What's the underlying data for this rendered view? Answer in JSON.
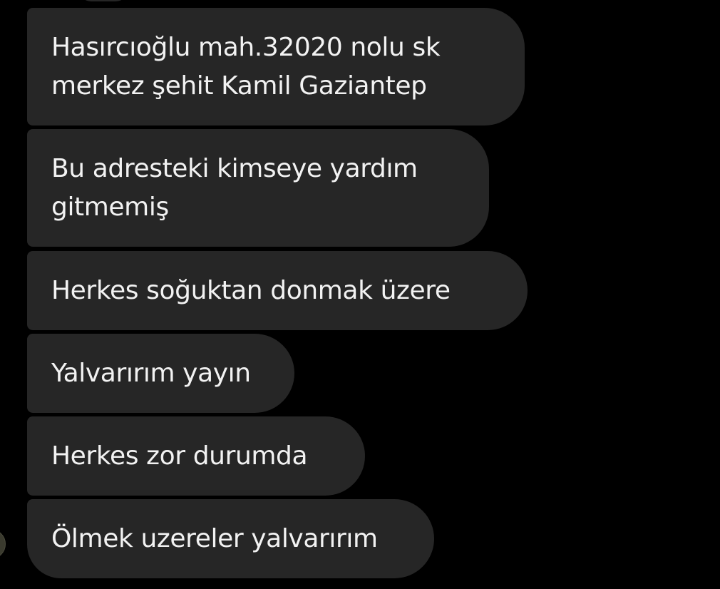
{
  "conversation": {
    "messages": [
      {
        "text": "Hasırcıoğlu mah.32020 nolu sk\nmerkez şehit Kamil Gaziantep"
      },
      {
        "text": "Bu adresteki kimseye yardım\ngitmemiş"
      },
      {
        "text": "Herkes soğuktan donmak üzere"
      },
      {
        "text": "Yalvarırım yayın"
      },
      {
        "text": "Herkes zor durumda"
      },
      {
        "text": "Ölmek uzereler yalvarırım"
      }
    ]
  },
  "colors": {
    "background": "#000000",
    "bubble": "#262626",
    "text": "#f2f2f2"
  }
}
